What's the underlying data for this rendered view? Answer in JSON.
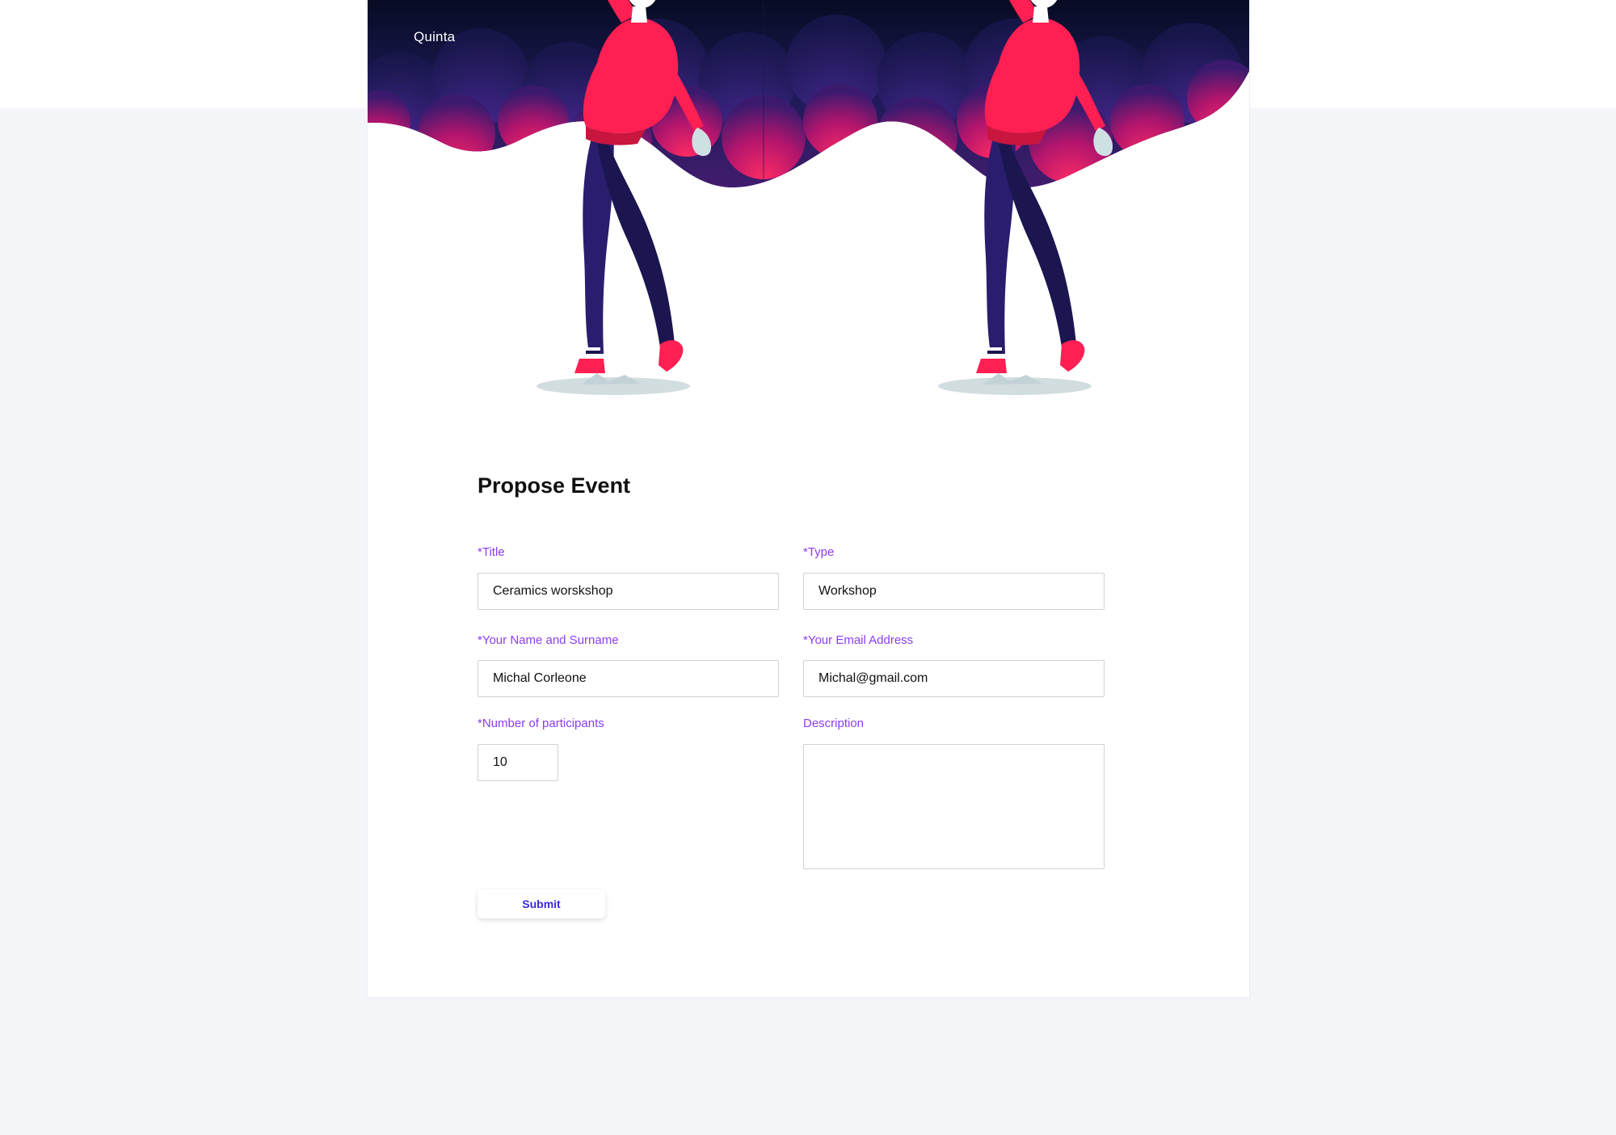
{
  "app": {
    "brand": "Quinta"
  },
  "form": {
    "title": "Propose Event",
    "fields": {
      "title": {
        "label": "*Title",
        "value": "Ceramics worskshop"
      },
      "type": {
        "label": "*Type",
        "value": "Workshop"
      },
      "name": {
        "label": "*Your Name and Surname",
        "value": "Michal Corleone"
      },
      "email": {
        "label": "*Your Email Address",
        "value": "Michal@gmail.com"
      },
      "participants": {
        "label": "*Number of participants",
        "value": "10"
      },
      "description": {
        "label": "Description",
        "value": ""
      }
    },
    "submit_label": "Submit"
  },
  "hero": {
    "illustrations": [
      "person-pointing-up-illustration",
      "person-pointing-up-illustration"
    ]
  },
  "colors": {
    "accent_label": "#8d3cf0",
    "submit_text": "#3a2ad8",
    "hero_dark": "#0b1030",
    "hero_purple": "#3a1f7a",
    "hero_pink": "#e8195a",
    "page_background": "#f4f5f9"
  }
}
